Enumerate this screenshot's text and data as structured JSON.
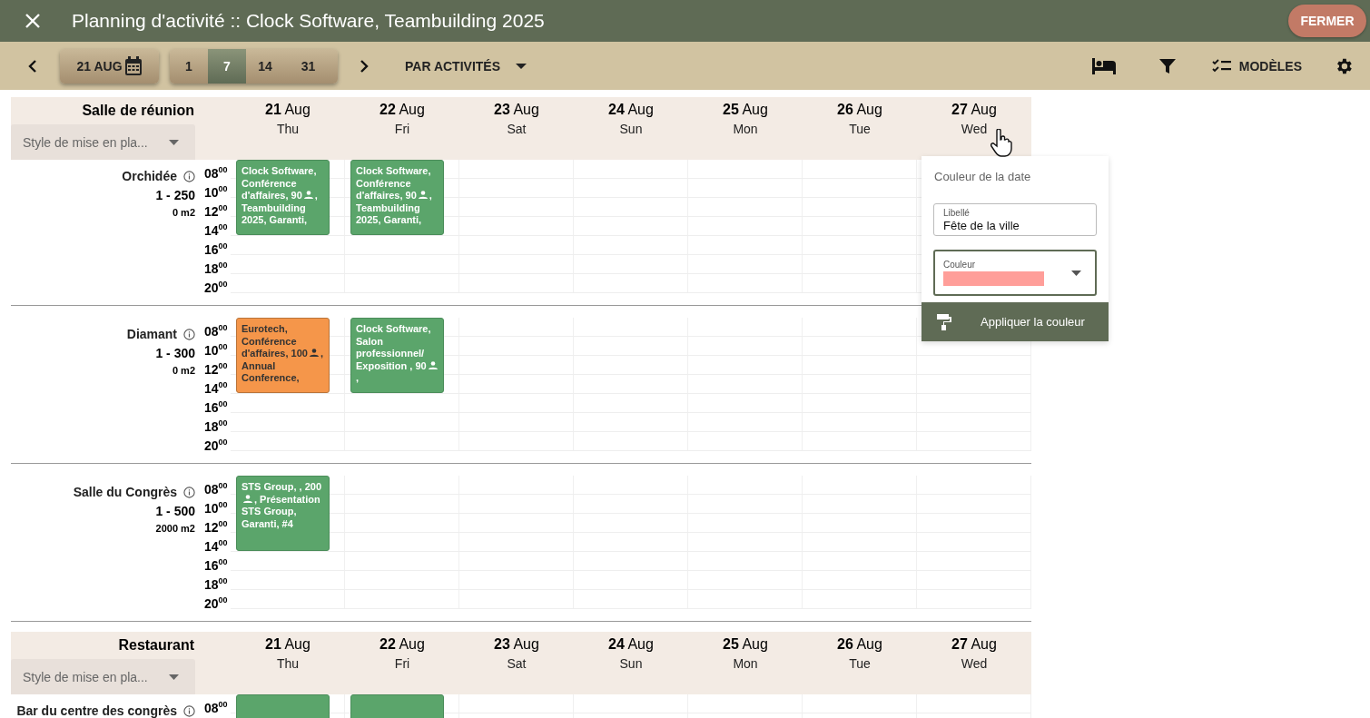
{
  "window": {
    "title": "Planning d'activité :: Clock Software, Teambuilding 2025",
    "close_button": "FERMER"
  },
  "toolbar": {
    "date": "21 AUG",
    "ranges": [
      {
        "label": "1",
        "selected": false
      },
      {
        "label": "7",
        "selected": true
      },
      {
        "label": "14",
        "selected": false
      },
      {
        "label": "31",
        "selected": false
      }
    ],
    "view": "PAR ACTIVITÉS",
    "templates": "MODÈLES"
  },
  "groups": [
    {
      "name": "Salle de réunion",
      "style_placeholder": "Style de mise en pla...",
      "days": [
        {
          "date": "**21** Aug",
          "weekday": "Thu"
        },
        {
          "date": "**22** Aug",
          "weekday": "Fri"
        },
        {
          "date": "**23** Aug",
          "weekday": "Sat"
        },
        {
          "date": "**24** Aug",
          "weekday": "Sun"
        },
        {
          "date": "**25** Aug",
          "weekday": "Mon"
        },
        {
          "date": "**26** Aug",
          "weekday": "Tue"
        },
        {
          "date": "**27** Aug",
          "weekday": "Wed"
        }
      ],
      "rooms": [
        {
          "name": "Orchidée",
          "capacity": "1 - 250",
          "area": "0 m2",
          "times": [
            "08$^{00}$",
            "10$^{00}$",
            "12$^{00}$",
            "14$^{00}$",
            "16$^{00}$",
            "18$^{00}$",
            "20$^{00}$"
          ],
          "events": [
            {
              "color": "#5ba56b",
              "text": "Clock Software, Conférence d'affaires, 90",
              "text_after": ", Teambuilding 2025, Garanti,"
            },
            {
              "color": "#5ba56b",
              "text": "Clock Software, Conférence d'affaires, 90",
              "text_after": ", Teambuilding 2025, Garanti,"
            }
          ]
        },
        {
          "name": "Diamant",
          "capacity": "1 - 300",
          "area": "0 m2",
          "times": [
            "08$^{00}$",
            "10$^{00}$",
            "12$^{00}$",
            "14$^{00}$",
            "16$^{00}$",
            "18$^{00}$",
            "20$^{00}$"
          ],
          "events": [
            {
              "color": "#f5964a",
              "text": "Eurotech, Conférence d'affaires, 100",
              "text_after": ", Annual Conference,"
            },
            {
              "color": "#5ba56b",
              "text": "Clock Software, Salon professionnel/ Exposition , 90",
              "text_after": ","
            }
          ]
        },
        {
          "name": "Salle du Congrès",
          "capacity": "1 - 500",
          "area": "2000 m2",
          "times": [
            "08$^{00}$",
            "10$^{00}$",
            "12$^{00}$",
            "14$^{00}$",
            "16$^{00}$",
            "18$^{00}$",
            "20$^{00}$"
          ],
          "events": [
            {
              "color": "#5ba56b",
              "text": "STS Group, , 200",
              "text_after": ", Présentation STS Group, Garanti, #4"
            }
          ]
        }
      ]
    },
    {
      "name": "Restaurant",
      "style_placeholder": "Style de mise en pla...",
      "days": [
        {
          "date": "**21** Aug",
          "weekday": "Thu"
        },
        {
          "date": "**22** Aug",
          "weekday": "Fri"
        },
        {
          "date": "**23** Aug",
          "weekday": "Sat"
        },
        {
          "date": "**24** Aug",
          "weekday": "Sun"
        },
        {
          "date": "**25** Aug",
          "weekday": "Mon"
        },
        {
          "date": "**26** Aug",
          "weekday": "Tue"
        },
        {
          "date": "**27** Aug",
          "weekday": "Wed"
        }
      ],
      "rooms": [
        {
          "name": "Bar du centre des congrès",
          "times": [
            "08$^{00}$"
          ],
          "events": [
            {
              "color": "#5ba56b"
            },
            {
              "color": "#5ba56b"
            }
          ]
        }
      ]
    }
  ],
  "popup": {
    "title": "Couleur de la date",
    "label_field": {
      "label": "Libellé",
      "value": "Fête de la ville"
    },
    "color_field": {
      "label": "Couleur",
      "color": "#ff9e99"
    },
    "apply_button": "Appliquer la couleur"
  }
}
